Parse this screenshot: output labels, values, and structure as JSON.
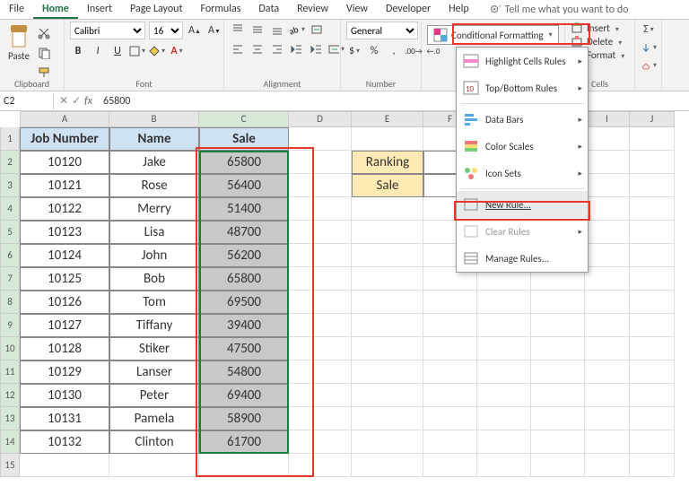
{
  "tabs": [
    "File",
    "Home",
    "Insert",
    "Page Layout",
    "Formulas",
    "Data",
    "Review",
    "View",
    "Developer",
    "Help"
  ],
  "active_tab": "Home",
  "tell_me": "Tell me what you want to do",
  "ribbon": {
    "clipboard": {
      "paste": "Paste",
      "label": "Clipboard"
    },
    "font": {
      "name": "Calibri",
      "size": "16",
      "label": "Font"
    },
    "alignment": {
      "label": "Alignment"
    },
    "number": {
      "format": "General",
      "label": "Number"
    },
    "cf_button": "Conditional Formatting",
    "cells": {
      "insert": "Insert",
      "delete": "Delete",
      "format": "Format",
      "label": "Cells"
    }
  },
  "formula_bar": {
    "cell_ref": "C2",
    "value": "65800"
  },
  "columns": [
    "A",
    "B",
    "C",
    "D",
    "E",
    "F",
    "G",
    "H",
    "I",
    "J"
  ],
  "headers": {
    "job": "Job Number",
    "name": "Name",
    "sale": "Sale"
  },
  "table": [
    {
      "job": "10120",
      "name": "Jake",
      "sale": "65800"
    },
    {
      "job": "10121",
      "name": "Rose",
      "sale": "56400"
    },
    {
      "job": "10122",
      "name": "Merry",
      "sale": "51400"
    },
    {
      "job": "10123",
      "name": "Lisa",
      "sale": "48700"
    },
    {
      "job": "10124",
      "name": "John",
      "sale": "56200"
    },
    {
      "job": "10125",
      "name": "Bob",
      "sale": "65800"
    },
    {
      "job": "10126",
      "name": "Tom",
      "sale": "69500"
    },
    {
      "job": "10127",
      "name": "Tiffany",
      "sale": "39400"
    },
    {
      "job": "10128",
      "name": "Stiker",
      "sale": "47500"
    },
    {
      "job": "10129",
      "name": "Lanser",
      "sale": "54800"
    },
    {
      "job": "10130",
      "name": "Peter",
      "sale": "69400"
    },
    {
      "job": "10131",
      "name": "Pamela",
      "sale": "58900"
    },
    {
      "job": "10132",
      "name": "Clinton",
      "sale": "61700"
    }
  ],
  "side": {
    "ranking": "Ranking",
    "sale": "Sale"
  },
  "cf_menu": {
    "items": [
      {
        "label": "Highlight Cells Rules",
        "sub": true
      },
      {
        "label": "Top/Bottom Rules",
        "sub": true
      },
      {
        "label": "Data Bars",
        "sub": true
      },
      {
        "label": "Color Scales",
        "sub": true
      },
      {
        "label": "Icon Sets",
        "sub": true
      },
      {
        "label": "New Rule...",
        "sub": false
      },
      {
        "label": "Clear Rules",
        "sub": true
      },
      {
        "label": "Manage Rules...",
        "sub": false
      }
    ]
  }
}
